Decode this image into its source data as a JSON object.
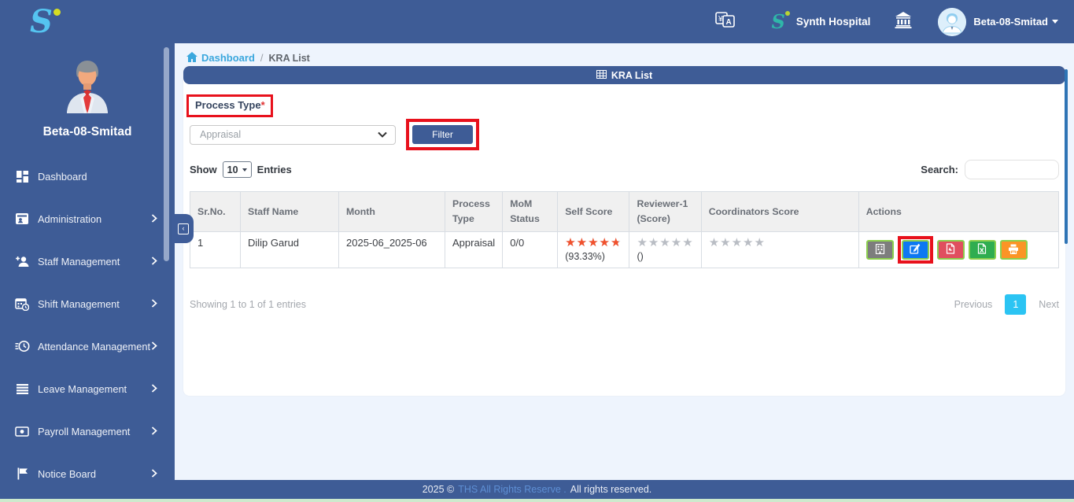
{
  "topbar": {
    "brand_initial": "S",
    "mini_brand_initial": "S",
    "hospital_name": "Synth Hospital",
    "username": "Beta-08-Smitad"
  },
  "sidebar": {
    "profile_name": "Beta-08-Smitad",
    "items": [
      {
        "label": "Dashboard",
        "icon": "dashboard-icon",
        "expandable": false
      },
      {
        "label": "Administration",
        "icon": "id-card-icon",
        "expandable": true
      },
      {
        "label": "Staff Management",
        "icon": "staff-plus-icon",
        "expandable": true
      },
      {
        "label": "Shift Management",
        "icon": "calendar-clock-icon",
        "expandable": true
      },
      {
        "label": "Attendance Management",
        "icon": "clock-history-icon",
        "expandable": true
      },
      {
        "label": "Leave Management",
        "icon": "list-lines-icon",
        "expandable": true
      },
      {
        "label": "Payroll Management",
        "icon": "banknote-icon",
        "expandable": true
      },
      {
        "label": "Notice Board",
        "icon": "flag-icon",
        "expandable": true
      }
    ]
  },
  "breadcrumb": {
    "home_label": "Dashboard",
    "separator": "/",
    "current": "KRA List"
  },
  "panel": {
    "title": "KRA List"
  },
  "filters": {
    "process_type_label": "Process Type",
    "required_marker": "*",
    "process_type_value": "Appraisal",
    "filter_button_label": "Filter"
  },
  "list_controls": {
    "show_label": "Show",
    "entries_per_page": "10",
    "entries_label": "Entries",
    "search_label": "Search:",
    "search_value": ""
  },
  "table": {
    "headers": [
      "Sr.No.",
      "Staff Name",
      "Month",
      "Process Type",
      "MoM Status",
      "Self Score",
      "Reviewer-1 (Score)",
      "Coordinators Score",
      "Actions"
    ],
    "rows": [
      {
        "sr_no": "1",
        "staff_name": "Dilip Garud",
        "month": "2025-06_2025-06",
        "process_type": "Appraisal",
        "mom_status": "0/0",
        "self_score": {
          "stars": "★★★★★",
          "fill_percent": "93.33%",
          "label": "(93.33%)"
        },
        "reviewer1_score": {
          "stars": "★★★★★",
          "label": "()"
        },
        "coordinators_score": {
          "stars": "★★★★★"
        },
        "actions": [
          {
            "name": "details",
            "icon": "building-grid-icon",
            "color": "#7d7d7d"
          },
          {
            "name": "edit",
            "icon": "edit-icon",
            "color": "#0d78f2",
            "annotated": true
          },
          {
            "name": "export-pdf",
            "icon": "pdf-file-icon",
            "color": "#e04f5f"
          },
          {
            "name": "export-excel",
            "icon": "excel-file-icon",
            "color": "#2fad50"
          },
          {
            "name": "print",
            "icon": "printer-icon",
            "color": "#fb9426"
          }
        ]
      }
    ]
  },
  "pagination": {
    "summary": "Showing 1 to 1 of 1 entries",
    "previous_label": "Previous",
    "current_page": "1",
    "next_label": "Next"
  },
  "footer": {
    "year_text": "2025 ©",
    "link_text": "THS All Rights Reserve .",
    "rights_text": "All rights reserved."
  },
  "colors": {
    "topbar_bg": "#3e5c96",
    "brand_blue": "#55c4f0",
    "brand_dot": "#d6de23",
    "content_bg": "#eef4fd",
    "breadcrumb_link": "#3aa7dd",
    "annotation_red": "#e8111c",
    "star_filled": "#f1512d",
    "star_empty": "#b9bdc4",
    "pagination_active": "#2bc4f3",
    "action_border_green": "#8ccf4d",
    "footer_link": "#5e8fd4",
    "bottom_strip_green": "#cde9cd"
  }
}
